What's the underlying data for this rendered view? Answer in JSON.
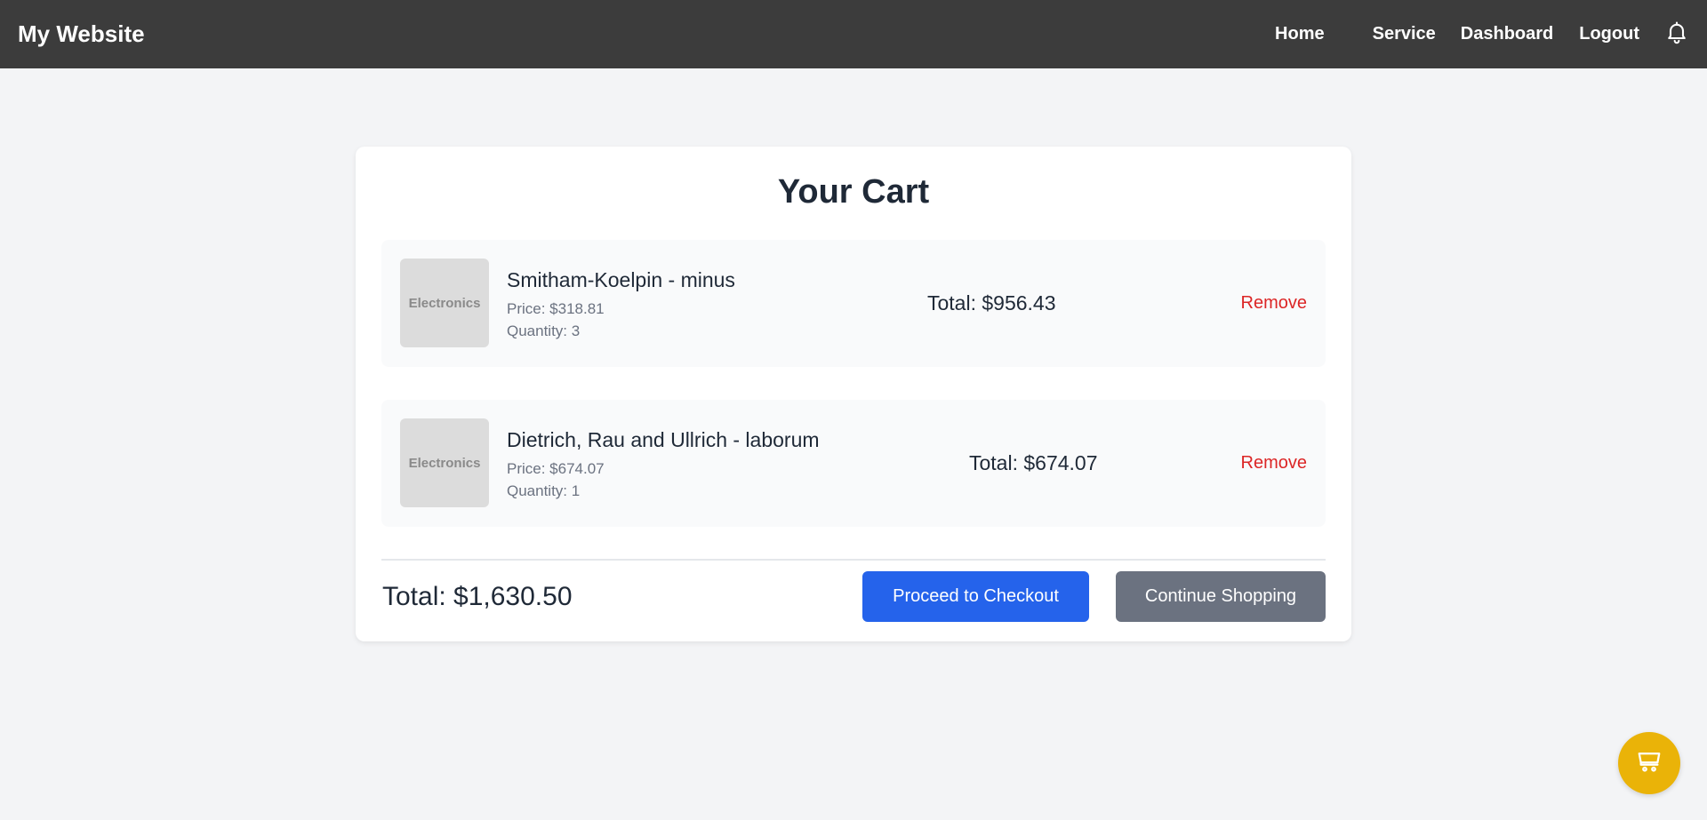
{
  "navbar": {
    "brand": "My Website",
    "links": [
      "Home",
      "Service",
      "Dashboard",
      "Logout"
    ],
    "notification_icon": "bell-icon"
  },
  "cart": {
    "title": "Your Cart",
    "items": [
      {
        "thumbnail_label": "Electronics",
        "name": "Smitham-Koelpin - minus",
        "price": "Price: $318.81",
        "quantity": "Quantity: 3",
        "total": "Total: $956.43",
        "remove_label": "Remove"
      },
      {
        "thumbnail_label": "Electronics",
        "name": "Dietrich, Rau and Ullrich - laborum",
        "price": "Price: $674.07",
        "quantity": "Quantity: 1",
        "total": "Total: $674.07",
        "remove_label": "Remove"
      }
    ],
    "grand_total": "Total: $1,630.50",
    "checkout_label": "Proceed to Checkout",
    "continue_label": "Continue Shopping"
  },
  "fab": {
    "icon": "shopping-cart-icon"
  },
  "colors": {
    "navbar_bg": "#3c3c3c",
    "page_bg": "#f3f4f6",
    "checkout_button": "#2563eb",
    "continue_button": "#6b7280",
    "remove_text": "#dc2626",
    "fab_bg": "#eab308"
  }
}
